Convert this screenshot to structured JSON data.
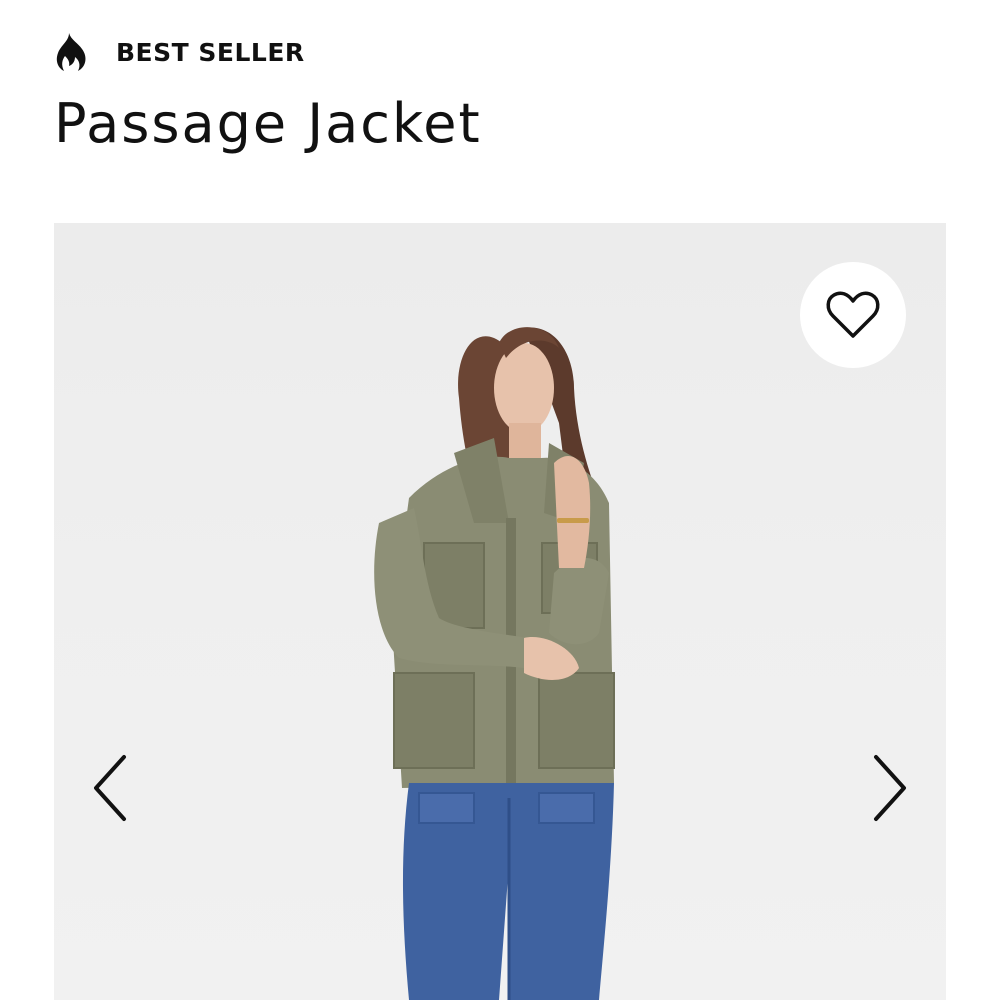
{
  "badge": {
    "icon": "flame-icon",
    "label": "BEST SELLER"
  },
  "product": {
    "title": "Passage Jacket"
  },
  "gallery": {
    "image_alt": "Model wearing olive green utility jacket with blue jeans",
    "wishlist_icon": "heart-outline-icon",
    "prev_icon": "chevron-left-icon",
    "next_icon": "chevron-right-icon"
  },
  "colors": {
    "text": "#111111",
    "gallery_bg": "#eeeeee",
    "jacket": "#8a8c73",
    "denim": "#3f62a0"
  }
}
